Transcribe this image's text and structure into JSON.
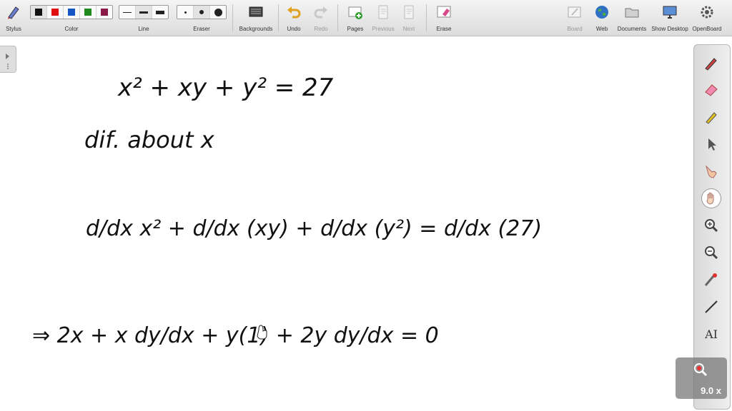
{
  "toolbar": {
    "stylus": "Stylus",
    "color": "Color",
    "line": "Line",
    "eraser": "Eraser",
    "backgrounds": "Backgrounds",
    "undo": "Undo",
    "redo": "Redo",
    "pages": "Pages",
    "previous": "Previous",
    "next": "Next",
    "erase": "Erase",
    "board": "Board",
    "web": "Web",
    "documents": "Documents",
    "show_desktop": "Show Desktop",
    "openboard": "OpenBoard",
    "colors": [
      "#111111",
      "#e01010",
      "#1457c4",
      "#1e8a1e",
      "#8a1a4a"
    ]
  },
  "board": {
    "line1": "x² + xy + y² = 27",
    "line2": "dif. about x",
    "line3": "d/dx x² + d/dx (xy) + d/dx (y²) = d/dx (27)",
    "line4": "⇒ 2x + x dy/dx + y(1) + 2y dy/dx = 0"
  },
  "dock": {
    "text_tool": "AI"
  },
  "zoom": {
    "level": "9.0 x"
  }
}
